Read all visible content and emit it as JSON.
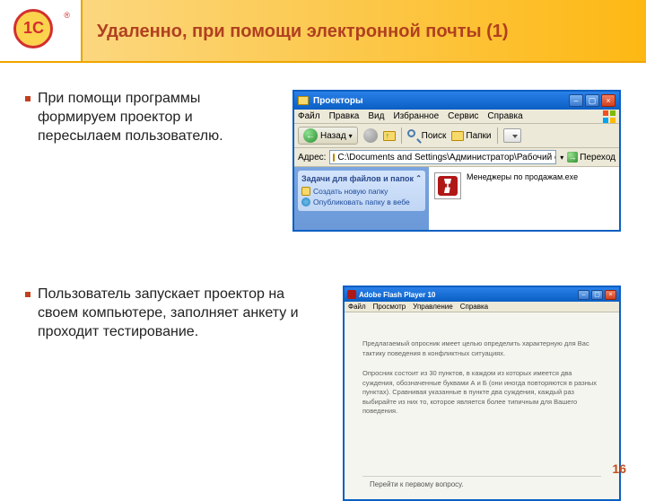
{
  "slide": {
    "title": "Удаленно, при помощи электронной почты (1)",
    "page_number": "16",
    "logo_text": "1C",
    "logo_r": "®"
  },
  "bullets": {
    "b1": "При помощи программы формируем проектор и пересылаем пользователю.",
    "b2": "Пользователь запускает проектор на своем компьютере, заполняет анкету и проходит тестирование."
  },
  "explorer": {
    "title": "Проекторы",
    "menu": {
      "file": "Файл",
      "edit": "Правка",
      "view": "Вид",
      "favorites": "Избранное",
      "tools": "Сервис",
      "help": "Справка"
    },
    "back": "Назад",
    "search": "Поиск",
    "folders": "Папки",
    "address_label": "Адрес:",
    "address_value": "C:\\Documents and Settings\\Администратор\\Рабочий стол\\Проекто",
    "go": "Переход",
    "tasks_title": "Задачи для файлов и папок",
    "task1": "Создать новую папку",
    "task2": "Опубликовать папку в вебе",
    "file_name": "Менеджеры по продажам.exe"
  },
  "flash": {
    "title": "Adobe Flash Player 10",
    "menu": {
      "file": "Файл",
      "view": "Просмотр",
      "control": "Управление",
      "help": "Справка"
    },
    "para1": "Предлагаемый опросник имеет целью определить характерную для Вас тактику поведения в конфликтных ситуациях.",
    "para2": "Опросник состоит из 30 пунктов, в каждом из которых имеется два суждения, обозначенные буквами А и Б (они иногда повторяются в разных пунктах). Сравнивая указанные в пункте два суждения, каждый раз выбирайте из них то, которое является более типичным для Вашего поведения.",
    "go_first": "Перейти к первому вопросу."
  }
}
